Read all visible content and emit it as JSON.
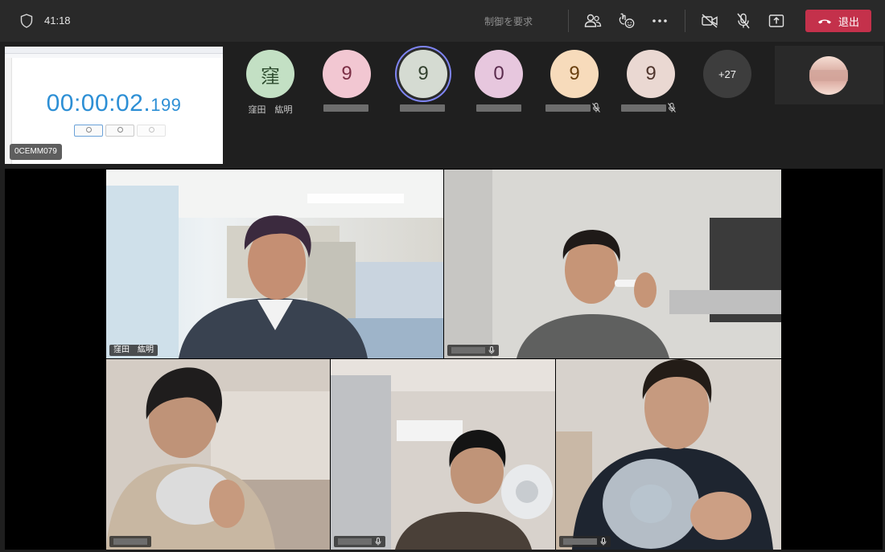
{
  "call": {
    "elapsed": "41:18",
    "control_request": "制御を要求",
    "leave_label": "退出"
  },
  "screen_share": {
    "stopwatch_main": "00:00:02.",
    "stopwatch_ms": "199",
    "presenter_tag": "0CEMM079"
  },
  "participants": [
    {
      "initial": "窪",
      "name": "窪田　紘明",
      "bg": "#c3e0c4",
      "fg": "#2c4a2d"
    },
    {
      "initial": "9",
      "name": "",
      "bg": "#f2c7d2",
      "fg": "#7b2e45"
    },
    {
      "initial": "9",
      "name": "",
      "bg": "#d5dbd2",
      "fg": "#33412f"
    },
    {
      "initial": "0",
      "name": "",
      "bg": "#e7c7de",
      "fg": "#5b2c4e"
    },
    {
      "initial": "9",
      "name": "",
      "bg": "#f7dbbb",
      "fg": "#6a4010"
    },
    {
      "initial": "9",
      "name": "",
      "bg": "#ead8d2",
      "fg": "#4e342c"
    }
  ],
  "overflow_count": "+27",
  "video_tiles": [
    {
      "label": "窪田　紘明"
    },
    {
      "label": ""
    },
    {
      "label": ""
    },
    {
      "label": ""
    },
    {
      "label": ""
    }
  ],
  "colors": {
    "accent_speaking": "#7f85f5",
    "leave_red": "#c4314b",
    "stopwatch_blue": "#2d8fd5"
  },
  "icons": [
    "shield-icon",
    "people-icon",
    "reaction-icon",
    "more-icon",
    "camera-off-icon",
    "mic-off-icon",
    "share-icon",
    "phone-hangup-icon"
  ]
}
